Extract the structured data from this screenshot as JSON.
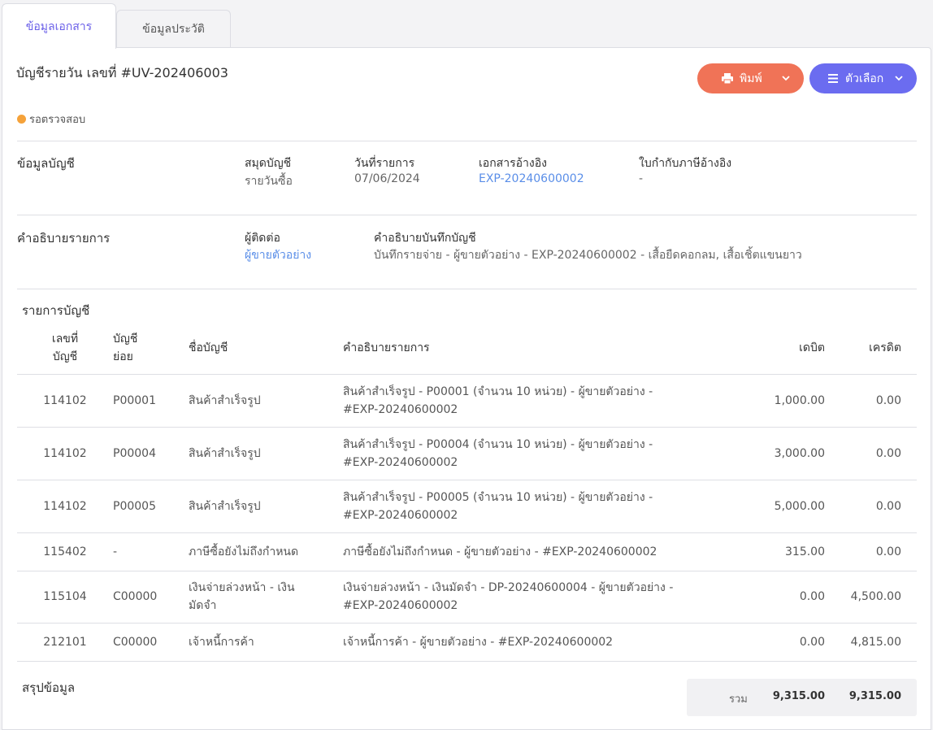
{
  "tabs": [
    "ข้อมูลเอกสาร",
    "ข้อมูลประวัติ"
  ],
  "doc_title": "บัญชีรายวัน เลขที่ #UV-202406003",
  "buttons": {
    "print": "พิมพ์",
    "options": "ตัวเลือก"
  },
  "status": "รอตรวจสอบ",
  "account_info": {
    "heading": "ข้อมูลบัญชี",
    "journal_label": "สมุดบัญชี",
    "journal_value": "รายวันซื้อ",
    "date_label": "วันที่รายการ",
    "date_value": "07/06/2024",
    "ref_label": "เอกสารอ้างอิง",
    "ref_value": "EXP-20240600002",
    "tax_label": "ใบกำกับภาษีอ้างอิง",
    "tax_value": "-"
  },
  "description": {
    "heading": "คำอธิบายรายการ",
    "contact_label": "ผู้ติดต่อ",
    "contact_value": "ผู้ขายตัวอย่าง",
    "note_label": "คำอธิบายบันทึกบัญชี",
    "note_value": "บันทึกรายจ่าย - ผู้ขายตัวอย่าง - EXP-20240600002 - เสื้อยืดคอกลม, เสื้อเชิ้ตแขนยาว"
  },
  "entries": {
    "heading": "รายการบัญชี",
    "columns": [
      "เลขที่\nบัญชี",
      "บัญชี\nย่อย",
      "ชื่อบัญชี",
      "คำอธิบายรายการ",
      "เดบิต",
      "เครดิต"
    ],
    "rows": [
      {
        "acct": "114102",
        "sub": "P00001",
        "name": "สินค้าสำเร็จรูป",
        "desc": "สินค้าสำเร็จรูป - P00001 (จำนวน 10 หน่วย) - ผู้ขายตัวอย่าง - #EXP-20240600002",
        "debit": "1,000.00",
        "credit": "0.00"
      },
      {
        "acct": "114102",
        "sub": "P00004",
        "name": "สินค้าสำเร็จรูป",
        "desc": "สินค้าสำเร็จรูป - P00004 (จำนวน 10 หน่วย) - ผู้ขายตัวอย่าง - #EXP-20240600002",
        "debit": "3,000.00",
        "credit": "0.00"
      },
      {
        "acct": "114102",
        "sub": "P00005",
        "name": "สินค้าสำเร็จรูป",
        "desc": "สินค้าสำเร็จรูป - P00005 (จำนวน 10 หน่วย) - ผู้ขายตัวอย่าง - #EXP-20240600002",
        "debit": "5,000.00",
        "credit": "0.00"
      },
      {
        "acct": "115402",
        "sub": "-",
        "name": "ภาษีซื้อยังไม่ถึงกำหนด",
        "desc": "ภาษีซื้อยังไม่ถึงกำหนด - ผู้ขายตัวอย่าง - #EXP-20240600002",
        "debit": "315.00",
        "credit": "0.00"
      },
      {
        "acct": "115104",
        "sub": "C00000",
        "name": "เงินจ่ายล่วงหน้า - เงินมัดจำ",
        "desc": "เงินจ่ายล่วงหน้า - เงินมัดจำ - DP-20240600004 - ผู้ขายตัวอย่าง - #EXP-20240600002",
        "debit": "0.00",
        "credit": "4,500.00"
      },
      {
        "acct": "212101",
        "sub": "C00000",
        "name": "เจ้าหนี้การค้า",
        "desc": "เจ้าหนี้การค้า - ผู้ขายตัวอย่าง - #EXP-20240600002",
        "debit": "0.00",
        "credit": "4,815.00"
      }
    ]
  },
  "summary": {
    "heading": "สรุปข้อมูล",
    "total_label": "รวม",
    "total_debit": "9,315.00",
    "total_credit": "9,315.00"
  },
  "colors": {
    "accent": "#6b6cf0",
    "print": "#f07357",
    "status_dot": "#f5a23a",
    "link": "#5a8ee8"
  }
}
